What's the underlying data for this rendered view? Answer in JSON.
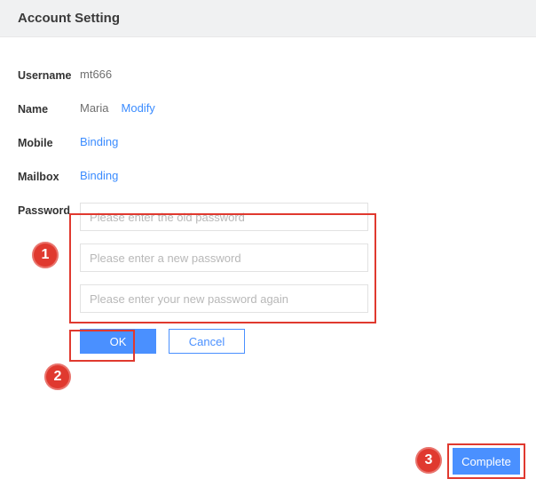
{
  "header": {
    "title": "Account Setting"
  },
  "fields": {
    "username": {
      "label": "Username",
      "value": "mt666"
    },
    "name": {
      "label": "Name",
      "value": "Maria",
      "action": "Modify"
    },
    "mobile": {
      "label": "Mobile",
      "action": "Binding"
    },
    "mailbox": {
      "label": "Mailbox",
      "action": "Binding"
    },
    "password": {
      "label": "Password"
    }
  },
  "password_form": {
    "old_placeholder": "Please enter the old password",
    "new_placeholder": "Please enter a new password",
    "confirm_placeholder": "Please enter your new password again",
    "ok_label": "OK",
    "cancel_label": "Cancel"
  },
  "footer": {
    "complete_label": "Complete"
  },
  "annotations": {
    "m1": "1",
    "m2": "2",
    "m3": "3"
  }
}
